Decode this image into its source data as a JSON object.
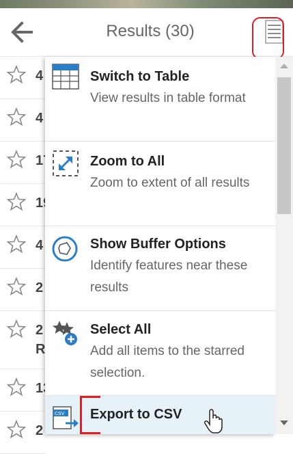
{
  "header": {
    "title": "Results (30)"
  },
  "list": {
    "rows": [
      {
        "text": "4"
      },
      {
        "text": "4"
      },
      {
        "text": "17"
      },
      {
        "text": "19"
      },
      {
        "text": "4"
      },
      {
        "text": "2"
      },
      {
        "text": "2\nR"
      },
      {
        "text": "13"
      },
      {
        "text": "2"
      }
    ]
  },
  "menu": {
    "items": [
      {
        "title": "Switch to Table",
        "desc": "View results in table format",
        "icon": "table-icon"
      },
      {
        "title": "Zoom to All",
        "desc": "Zoom to extent of all results",
        "icon": "zoom-extent-icon"
      },
      {
        "title": "Show Buffer Options",
        "desc": "Identify features near these results",
        "icon": "buffer-icon"
      },
      {
        "title": "Select All",
        "desc": "Add all items to the starred selection.",
        "icon": "select-all-icon"
      },
      {
        "title": "Export to CSV",
        "desc": "",
        "icon": "csv-export-icon"
      }
    ]
  },
  "colors": {
    "accent": "#2a7ec8",
    "annotation": "#e31b23",
    "highlight": "#e7f1f8"
  }
}
